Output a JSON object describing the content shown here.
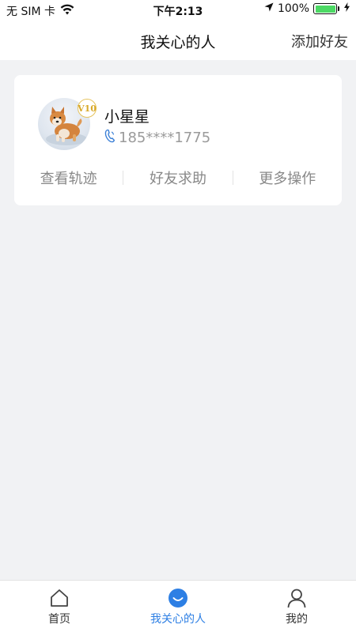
{
  "status_bar": {
    "carrier": "无 SIM 卡",
    "time": "下午2:13",
    "battery_percent": "100%",
    "battery_level": 1.0
  },
  "nav": {
    "title": "我关心的人",
    "add_friend": "添加好友"
  },
  "friend_card": {
    "name": "小星星",
    "phone": "185****1775",
    "badge": "V10",
    "actions": [
      "查看轨迹",
      "好友求助",
      "更多操作"
    ]
  },
  "tabs": [
    {
      "label": "首页",
      "icon": "home-icon",
      "active": false
    },
    {
      "label": "我关心的人",
      "icon": "smile-icon",
      "active": true
    },
    {
      "label": "我的",
      "icon": "person-icon",
      "active": false
    }
  ],
  "colors": {
    "accent": "#2d7fe4",
    "background": "#f1f2f4",
    "battery": "#4cd964",
    "badge_gold": "#d8a92a"
  }
}
